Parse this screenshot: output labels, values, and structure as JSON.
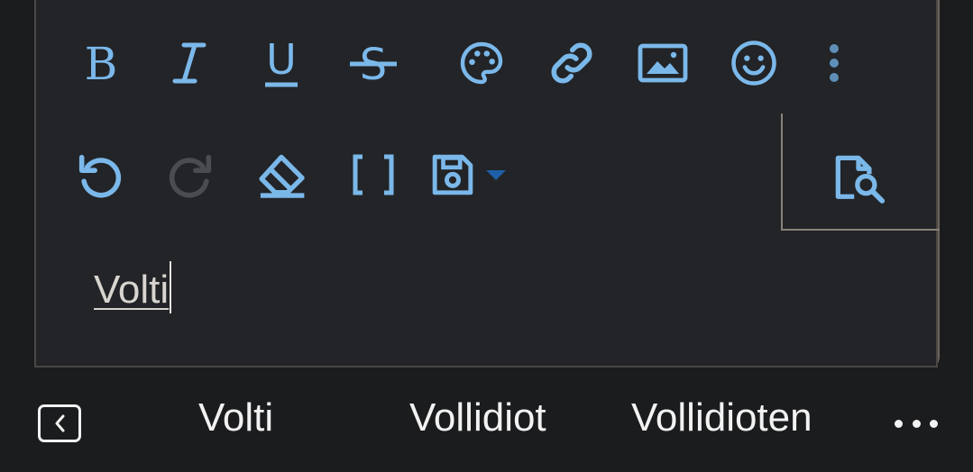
{
  "colors": {
    "toolbar_icon": "#7bb8ea",
    "toolbar_icon_disabled": "#4a4c4f",
    "save_dropdown_arrow": "#1f5fa8",
    "editor_background": "#222427",
    "suggestion_text": "#f2f2f2"
  },
  "toolbar": {
    "row1": [
      {
        "name": "bold-icon",
        "glyph": "B"
      },
      {
        "name": "italic-icon",
        "glyph": "I"
      },
      {
        "name": "underline-icon",
        "glyph": "U"
      },
      {
        "name": "strikethrough-icon",
        "glyph": "S"
      },
      {
        "name": "palette-icon"
      },
      {
        "name": "link-icon"
      },
      {
        "name": "image-icon"
      },
      {
        "name": "emoji-icon"
      },
      {
        "name": "more-vertical-icon"
      }
    ],
    "row2": [
      {
        "name": "undo-icon"
      },
      {
        "name": "redo-icon",
        "disabled": true
      },
      {
        "name": "eraser-icon"
      },
      {
        "name": "code-brackets-icon"
      },
      {
        "name": "save-draft-icon"
      },
      {
        "name": "dropdown-arrow-icon"
      },
      {
        "name": "preview-icon"
      }
    ]
  },
  "editor": {
    "text": "Volti"
  },
  "suggestions": {
    "items": [
      "Volti",
      "Vollidiot",
      "Vollidioten"
    ]
  }
}
